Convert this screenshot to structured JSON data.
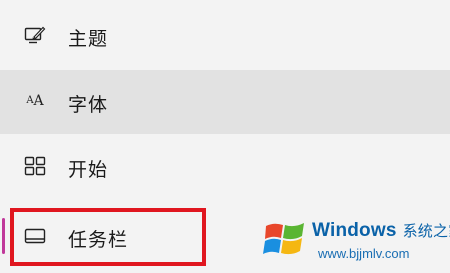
{
  "menu": {
    "items": [
      {
        "label": "主题",
        "icon": "theme-brush-icon",
        "selected": false,
        "hovered": false
      },
      {
        "label": "字体",
        "icon": "font-icon",
        "icon_text": "AA",
        "selected": false,
        "hovered": true
      },
      {
        "label": "开始",
        "icon": "start-menu-icon",
        "selected": false,
        "hovered": false
      },
      {
        "label": "任务栏",
        "icon": "taskbar-icon",
        "selected": true,
        "hovered": false
      }
    ]
  },
  "annotation": {
    "highlight_color": "#e0161f",
    "highlighted_item": "任务栏"
  },
  "colors": {
    "background": "#f3f3f3",
    "hover_background": "#e2e2e2",
    "selected_indicator": "#c0389a",
    "watermark_blue": "#0a62a8"
  },
  "watermark": {
    "brand": "Windows",
    "brand_cn": "系统之家",
    "url": "www.bjjmlv.com",
    "logo_icon": "windows-flag-logo-icon"
  }
}
